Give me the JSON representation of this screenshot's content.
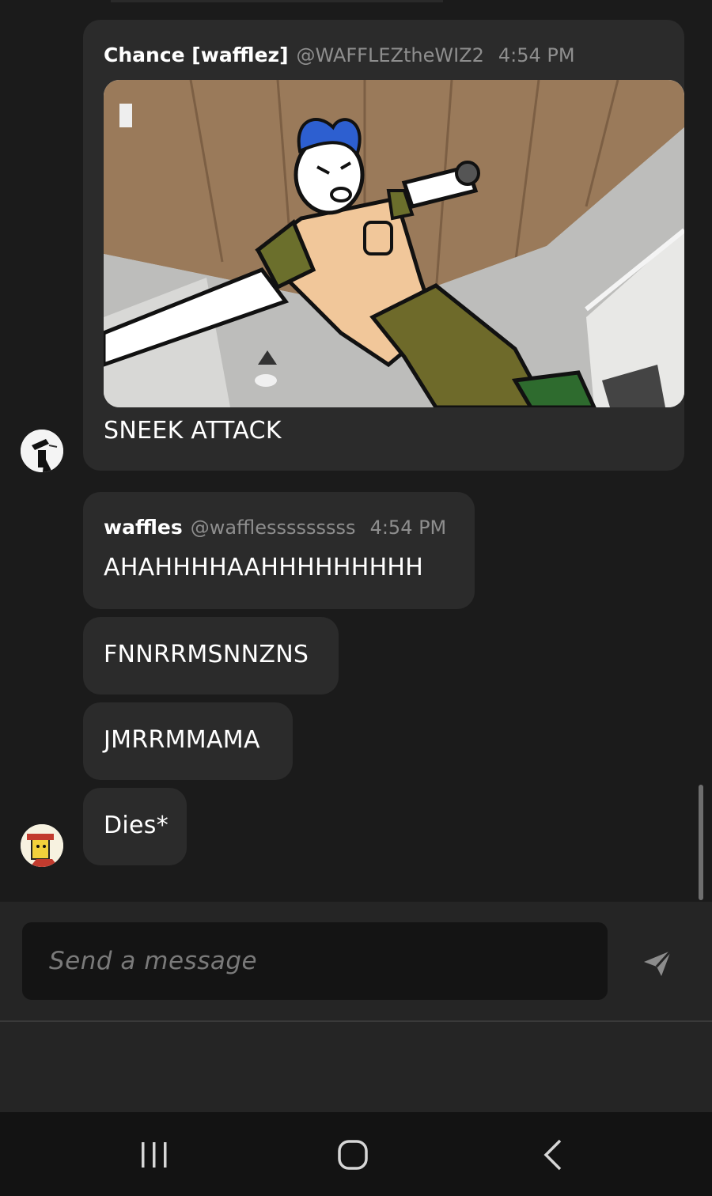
{
  "messages": [
    {
      "author": "Chance [wafflez]",
      "handle": "@WAFFLEZtheWIZ2",
      "time": "4:54 PM",
      "text": "SNEEK ATTACK",
      "attachment": "image"
    },
    {
      "author": "waffles",
      "handle": "@wafflesssssssss",
      "time": "4:54 PM",
      "texts": [
        "AHAHHHHAAHHHHHHHHH",
        "FNNRRMSNNZNS",
        "JMRRMMAMA",
        "Dies*"
      ]
    }
  ],
  "composer": {
    "placeholder": "Send a message",
    "send_icon": "send-icon"
  },
  "navbar": {
    "recent_icon": "recent-apps-icon",
    "home_icon": "home-icon",
    "back_icon": "back-icon"
  },
  "colors": {
    "background": "#1b1b1b",
    "bubble": "#2b2b2b",
    "meta_text": "#8e8e8e",
    "composer": "#252525",
    "input": "#141414",
    "navbar": "#131313"
  }
}
